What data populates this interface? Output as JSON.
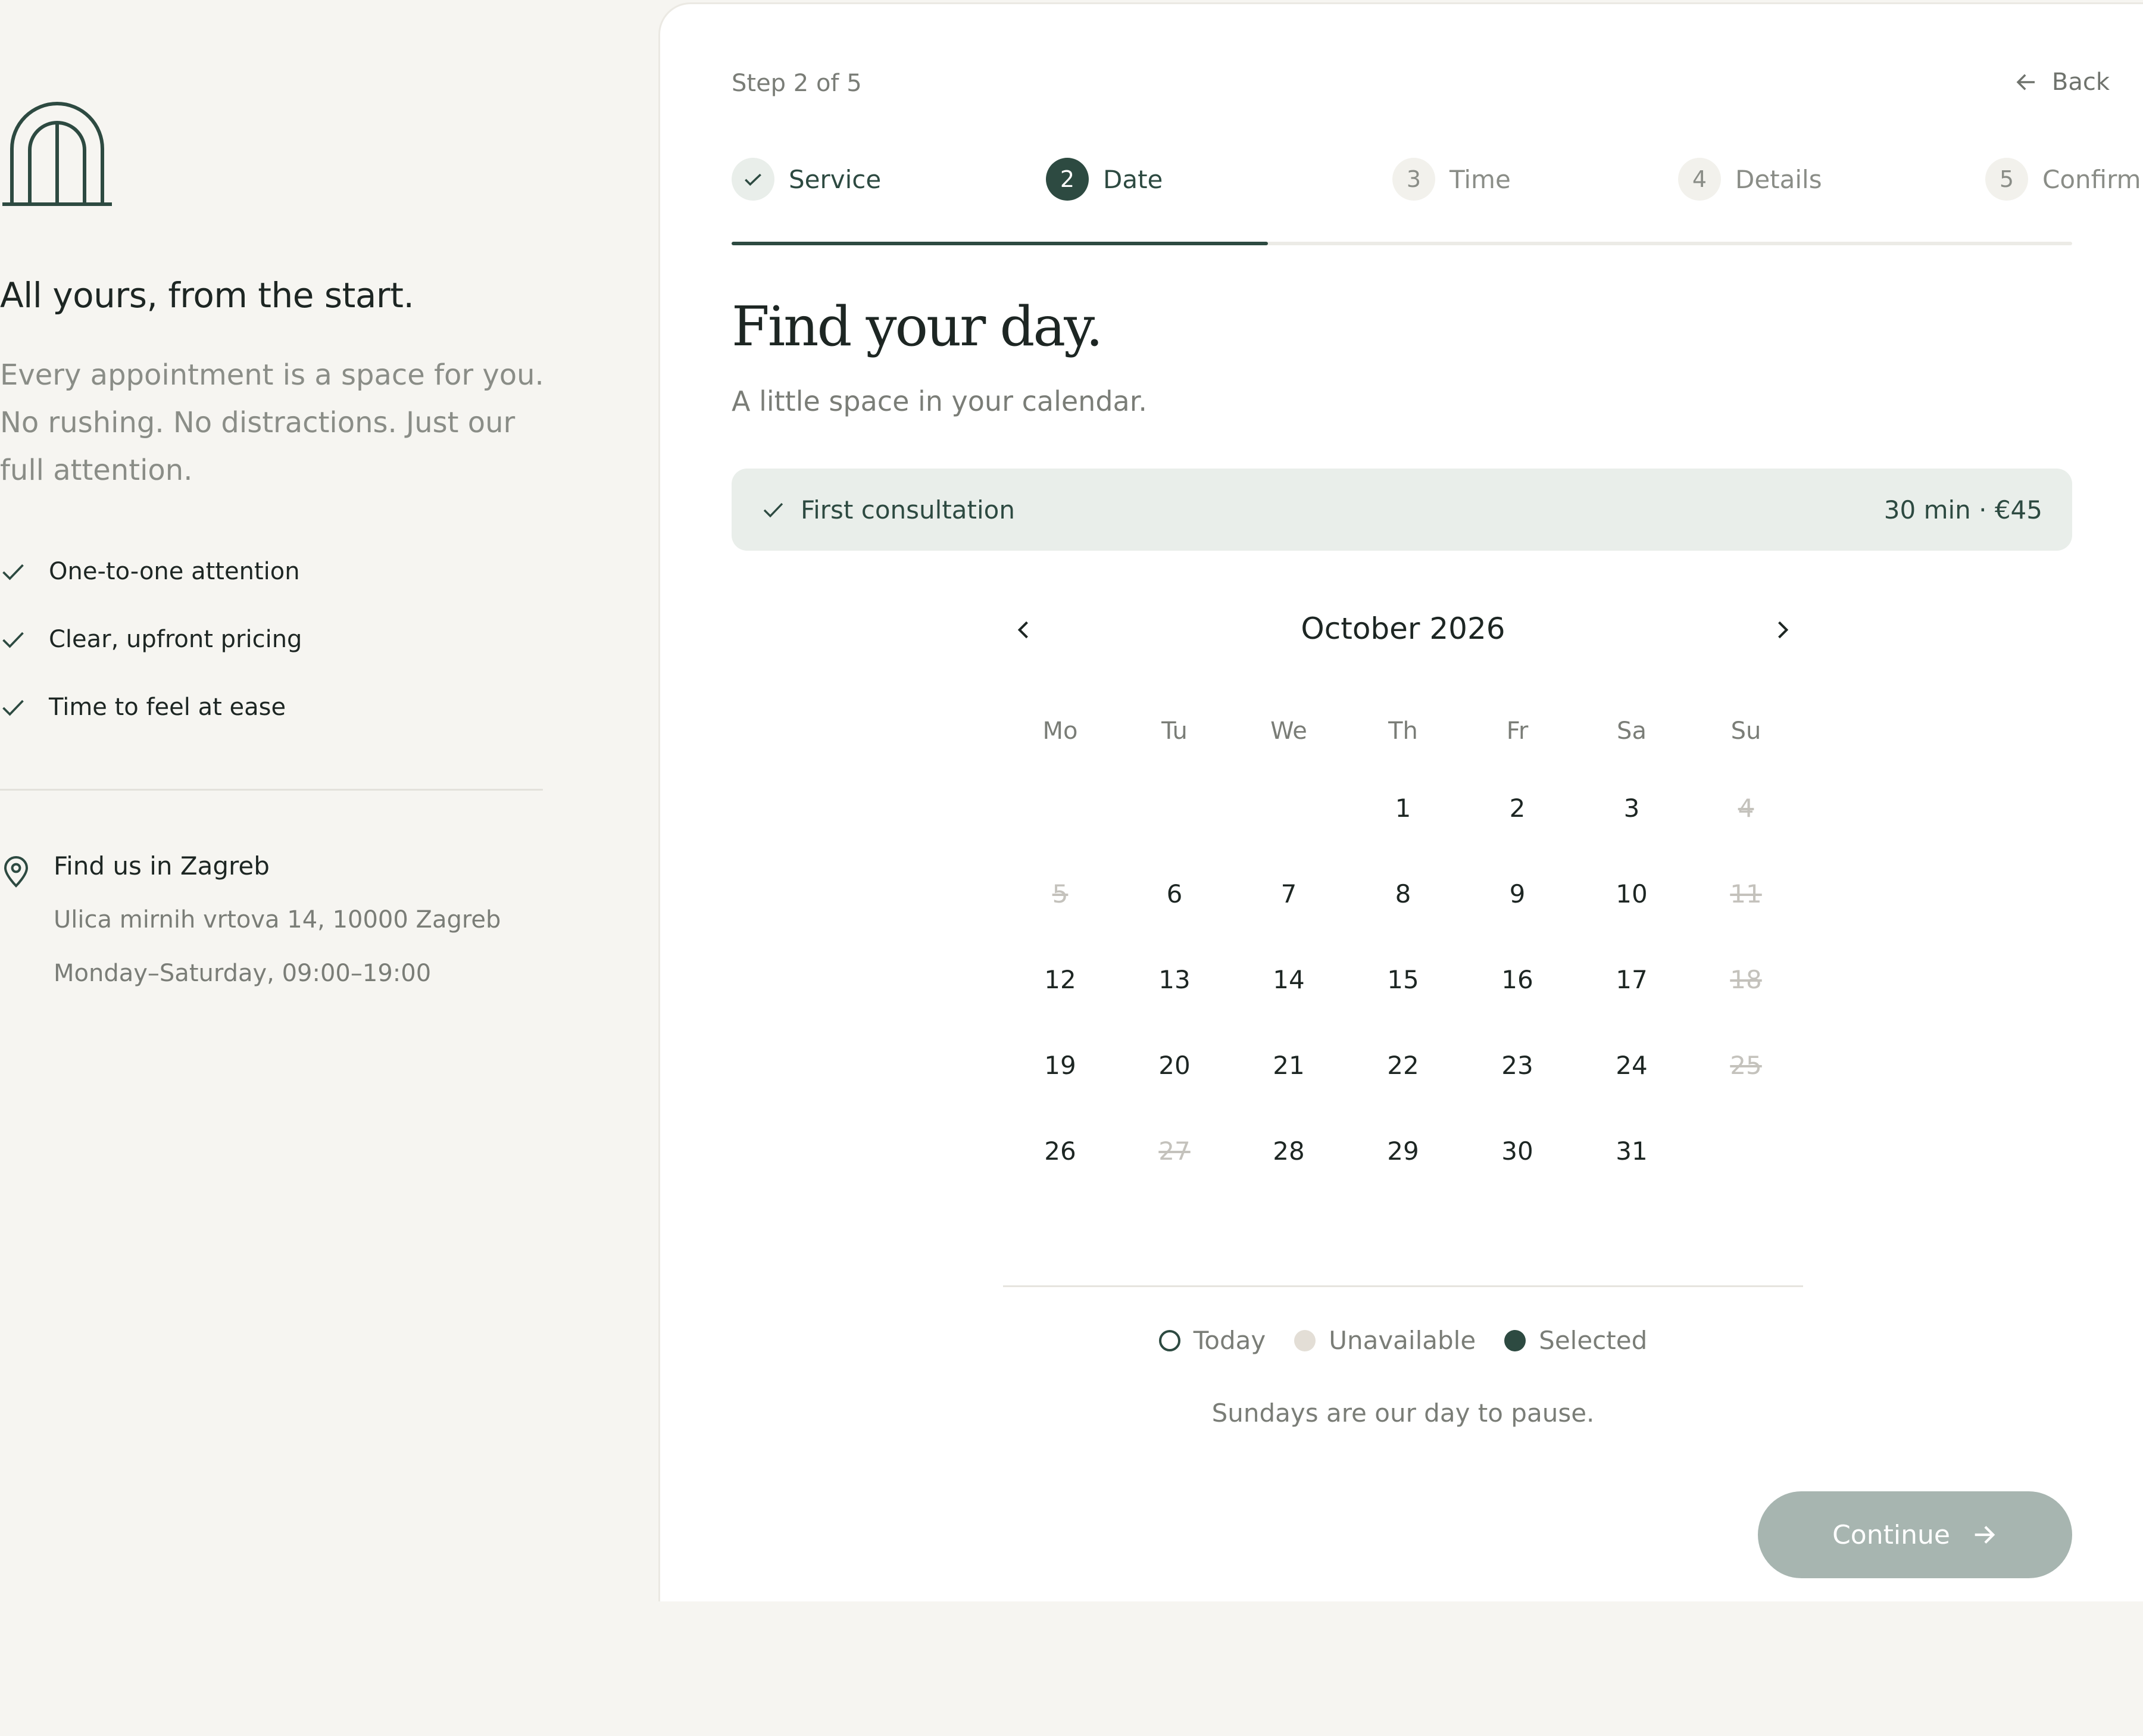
{
  "brand": {
    "tagline": "All yours, from the start.",
    "intro": "Every appointment is a space for you. No rushing. No distractions. Just our full attention.",
    "perks": [
      "One-to-one attention",
      "Clear, upfront pricing",
      "Time to feel at ease"
    ],
    "location": {
      "title": "Find us in Zagreb",
      "address": "Ulica mirnih vrtova 14, 10000 Zagreb",
      "hours": "Monday–Saturday, 09:00–19:00"
    },
    "accent_color": "#2d4a41"
  },
  "wizard": {
    "step_label": "Step 2 of 5",
    "back_label": "Back",
    "progress_fraction": 0.4,
    "steps": [
      {
        "number": "1",
        "label": "Service",
        "state": "done"
      },
      {
        "number": "2",
        "label": "Date",
        "state": "active"
      },
      {
        "number": "3",
        "label": "Time",
        "state": "todo"
      },
      {
        "number": "4",
        "label": "Details",
        "state": "todo"
      },
      {
        "number": "5",
        "label": "Confirm",
        "state": "todo"
      }
    ]
  },
  "page": {
    "title": "Find your day.",
    "subtitle": "A little space in your calendar."
  },
  "service": {
    "name": "First consultation",
    "meta": "30 min · €45"
  },
  "calendar": {
    "month_label": "October 2026",
    "weekdays": [
      "Mo",
      "Tu",
      "We",
      "Th",
      "Fr",
      "Sa",
      "Su"
    ],
    "first_weekday_index": 3,
    "days_in_month": 31,
    "unavailable_days": [
      4,
      5,
      11,
      18,
      25,
      27
    ],
    "legend": {
      "today": "Today",
      "unavailable": "Unavailable",
      "selected": "Selected"
    },
    "note": "Sundays are our day to pause."
  },
  "actions": {
    "continue_label": "Continue"
  }
}
